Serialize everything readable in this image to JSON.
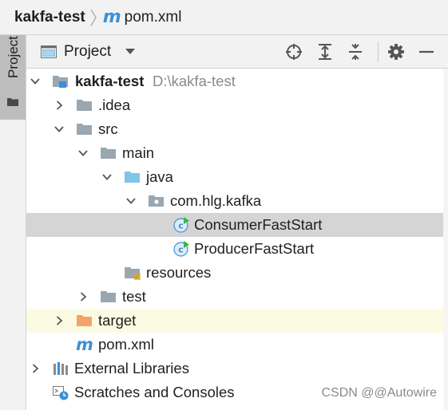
{
  "breadcrumb": {
    "project": "kakfa-test",
    "file_icon": "maven-m-icon",
    "file_icon_glyph": "m",
    "file": "pom.xml"
  },
  "tool_window": {
    "tab_label": "Project",
    "view_mode": "Project",
    "toolbar_icons": [
      "locate-icon",
      "expand-all-icon",
      "collapse-all-icon",
      "settings-gear-icon",
      "hide-minus-icon"
    ]
  },
  "tree": {
    "root_name": "kakfa-test",
    "root_path": "D:\\kakfa-test",
    "idea": ".idea",
    "src": "src",
    "main": "main",
    "java": "java",
    "package": "com.hlg.kafka",
    "class1": "ConsumerFastStart",
    "class2": "ProducerFastStart",
    "resources": "resources",
    "test": "test",
    "target": "target",
    "pom": "pom.xml",
    "pom_glyph": "m",
    "ext_libs": "External Libraries",
    "scratches": "Scratches and Consoles",
    "selected_item": "ConsumerFastStart"
  },
  "colors": {
    "selection": "#d5d5d5",
    "excluded_bg": "#fbfbe3",
    "folder_gray": "#9aa7b0",
    "source_folder": "#7fc5e8",
    "excluded_folder": "#f5a36a",
    "maven_blue": "#3d8fd6",
    "class_icon": "#3d8fd6",
    "run_marker": "#3bb54a"
  },
  "watermark": "CSDN @@Autowire"
}
